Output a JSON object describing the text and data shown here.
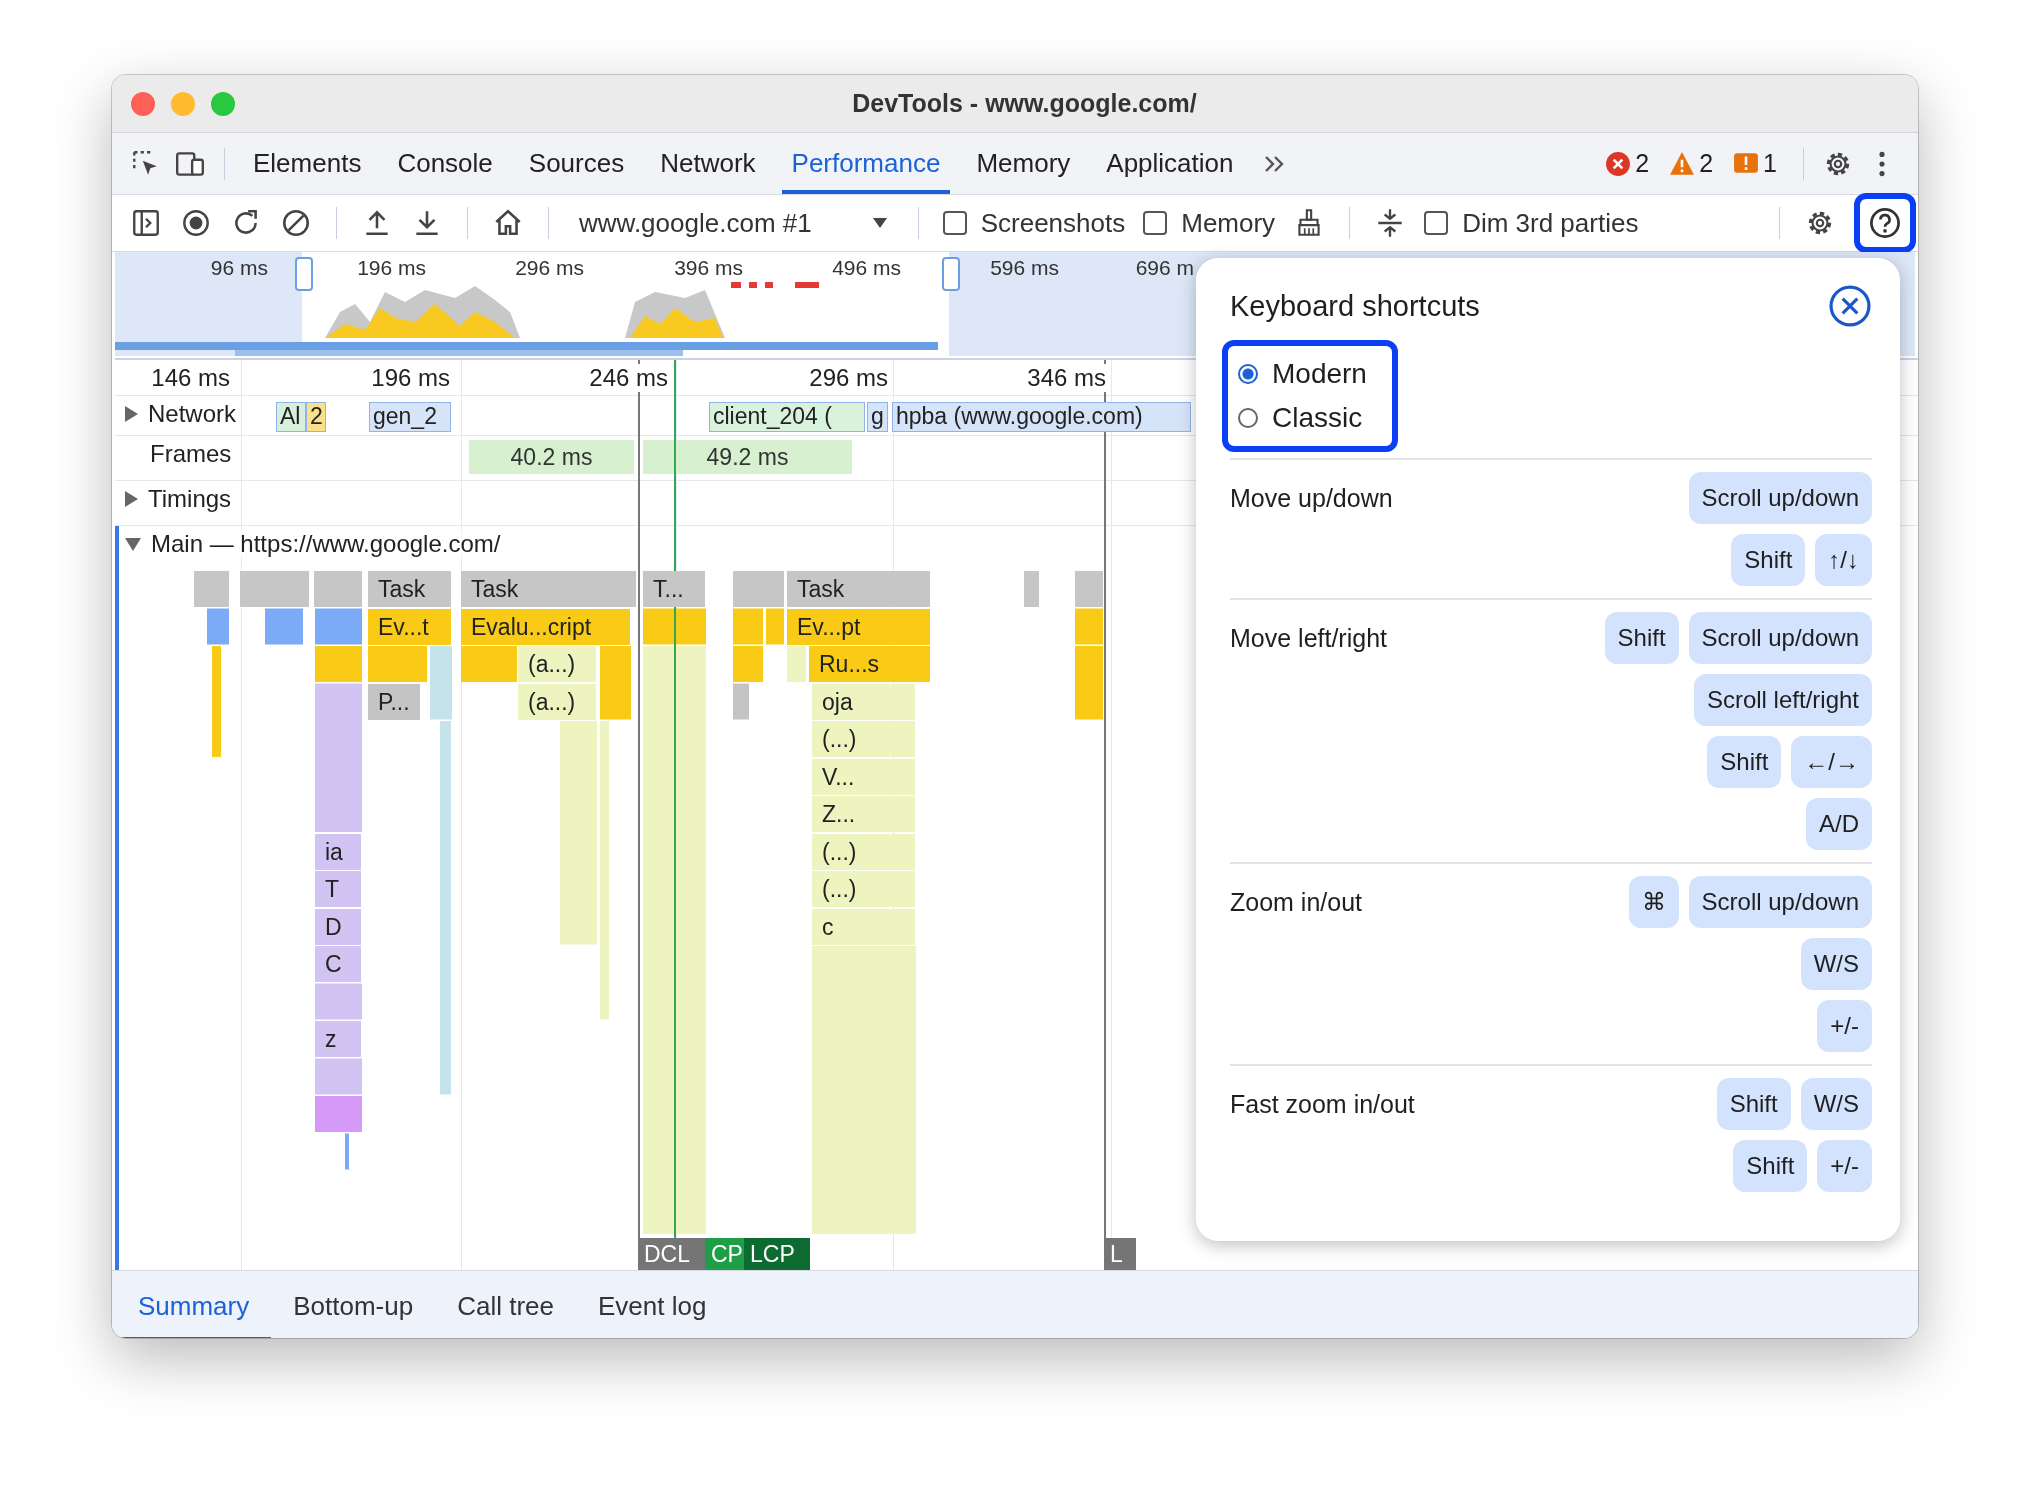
{
  "window": {
    "title": "DevTools - www.google.com/"
  },
  "tabs": [
    {
      "label": "Elements",
      "selected": false
    },
    {
      "label": "Console",
      "selected": false
    },
    {
      "label": "Sources",
      "selected": false
    },
    {
      "label": "Network",
      "selected": false
    },
    {
      "label": "Performance",
      "selected": true
    },
    {
      "label": "Memory",
      "selected": false
    },
    {
      "label": "Application",
      "selected": false
    }
  ],
  "issues": [
    {
      "kind": "error",
      "count": "2"
    },
    {
      "kind": "warning",
      "count": "2"
    },
    {
      "kind": "info",
      "count": "1"
    }
  ],
  "toolbar": {
    "recording": "www.google.com #1",
    "checkboxes": [
      {
        "label": "Screenshots",
        "checked": false
      },
      {
        "label": "Memory",
        "checked": false
      },
      {
        "label": "Dim 3rd parties",
        "checked": false
      }
    ]
  },
  "overview": {
    "ticks": [
      "96 ms",
      "196 ms",
      "296 ms",
      "396 ms",
      "496 ms",
      "596 ms",
      "696 m"
    ]
  },
  "ruler": [
    "146 ms",
    "196 ms",
    "246 ms",
    "296 ms",
    "346 ms"
  ],
  "tracks": {
    "network": {
      "label": "Network",
      "expanded": false,
      "requests": [
        {
          "label": "Al",
          "color": "#d6f0dc"
        },
        {
          "label": "2",
          "color": "#fbe08a"
        },
        {
          "label": "gen_2",
          "color": "#d6e4fa"
        },
        {
          "label": "client_204 (",
          "color": "#d8f2dc"
        },
        {
          "label": "g",
          "color": "#d6e4fa"
        },
        {
          "label": "hpba (www.google.com)",
          "color": "#d6e4fa"
        }
      ]
    },
    "frames": {
      "label": "Frames",
      "items": [
        "40.2 ms",
        "49.2 ms"
      ]
    },
    "timings": {
      "label": "Timings",
      "expanded": false
    },
    "main": {
      "label": "Main — https://www.google.com/",
      "expanded": true
    }
  },
  "flame": [
    {
      "label": "Task",
      "kind": "task"
    },
    {
      "label": "Task",
      "kind": "task"
    },
    {
      "label": "T...",
      "kind": "task"
    },
    {
      "label": "Task",
      "kind": "task"
    },
    {
      "label": "Ev...t",
      "kind": "script"
    },
    {
      "label": "Evalu...cript",
      "kind": "script"
    },
    {
      "label": "Ev...pt",
      "kind": "script"
    },
    {
      "label": "(a...)",
      "kind": "function"
    },
    {
      "label": "Ru...s",
      "kind": "script"
    },
    {
      "label": "P...",
      "kind": "other"
    },
    {
      "label": "(a...)",
      "kind": "function"
    },
    {
      "label": "oja",
      "kind": "function"
    },
    {
      "label": "(...)",
      "kind": "function"
    },
    {
      "label": "V...",
      "kind": "function"
    },
    {
      "label": "Z...",
      "kind": "function"
    },
    {
      "label": "ia",
      "kind": "rendering"
    },
    {
      "label": "(...)",
      "kind": "function"
    },
    {
      "label": "T",
      "kind": "rendering"
    },
    {
      "label": "(...)",
      "kind": "function"
    },
    {
      "label": "D",
      "kind": "rendering"
    },
    {
      "label": "c",
      "kind": "function"
    },
    {
      "label": "C",
      "kind": "rendering"
    },
    {
      "label": "z",
      "kind": "rendering"
    }
  ],
  "markers": [
    {
      "label": "DCL",
      "kind": "dcl"
    },
    {
      "label": "CP",
      "kind": "fcp"
    },
    {
      "label": "LCP",
      "kind": "lcp"
    },
    {
      "label": "L",
      "kind": "load"
    }
  ],
  "bottom_tabs": [
    {
      "label": "Summary",
      "selected": true
    },
    {
      "label": "Bottom-up",
      "selected": false
    },
    {
      "label": "Call tree",
      "selected": false
    },
    {
      "label": "Event log",
      "selected": false
    }
  ],
  "shortcuts_dialog": {
    "title": "Keyboard shortcuts",
    "modes": [
      {
        "label": "Modern",
        "selected": true
      },
      {
        "label": "Classic",
        "selected": false
      }
    ],
    "sections": [
      {
        "action": "Move up/down",
        "combos": [
          [
            "Scroll up/down"
          ],
          [
            "Shift",
            "↑/↓"
          ]
        ]
      },
      {
        "action": "Move left/right",
        "combos": [
          [
            "Shift",
            "Scroll up/down"
          ],
          [
            "Scroll left/right"
          ],
          [
            "Shift",
            "←/→"
          ],
          [
            "A/D"
          ]
        ]
      },
      {
        "action": "Zoom in/out",
        "combos": [
          [
            "⌘",
            "Scroll up/down"
          ],
          [
            "W/S"
          ],
          [
            "+/-"
          ]
        ]
      },
      {
        "action": "Fast zoom in/out",
        "combos": [
          [
            "Shift",
            "W/S"
          ],
          [
            "Shift",
            "+/-"
          ]
        ]
      }
    ]
  }
}
